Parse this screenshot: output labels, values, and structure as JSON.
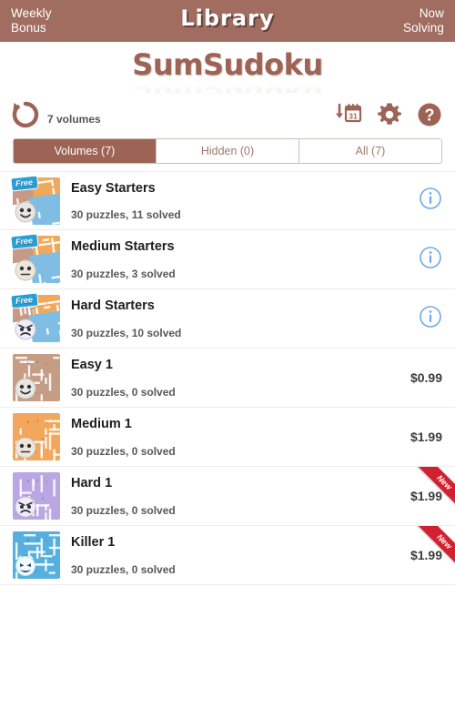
{
  "topbar": {
    "left_line1": "Weekly",
    "left_line2": "Bonus",
    "title": "Library",
    "right_line1": "Now",
    "right_line2": "Solving",
    "background_color": "#a06d60"
  },
  "logo": {
    "text": "SumSudoku",
    "color": "#9d6354"
  },
  "toolbar": {
    "restore_icon": "restore-circular-arrow-icon",
    "volumes_label": "7 volumes",
    "download_icon": "download-calendar-31-icon",
    "calendar_day": "31",
    "settings_icon": "gear-icon",
    "help_icon": "question-mark-circle-icon",
    "icon_color": "#9d6354"
  },
  "tabs": [
    {
      "label": "Volumes (7)",
      "active": true
    },
    {
      "label": "Hidden (0)",
      "active": false
    },
    {
      "label": "All (7)",
      "active": false
    }
  ],
  "accent_color": "#9d6354",
  "info_icon_color": "#6ea8e8",
  "new_ribbon_color": "#d32030",
  "free_badge_color": "#2a9fd6",
  "volumes": [
    {
      "title": "Easy Starters",
      "subtitle": "30 puzzles,  11 solved",
      "free": true,
      "free_label": "Free",
      "new": false,
      "price": "",
      "action": "info",
      "thumb_style": "collage",
      "face": "smile",
      "colors": [
        "#c79a86",
        "#f0a95a",
        "#7fbde4"
      ]
    },
    {
      "title": "Medium Starters",
      "subtitle": "30 puzzles,  3 solved",
      "free": true,
      "free_label": "Free",
      "new": false,
      "price": "",
      "action": "info",
      "thumb_style": "collage",
      "face": "neutral",
      "colors": [
        "#c79a86",
        "#f0a95a",
        "#7fbde4"
      ]
    },
    {
      "title": "Hard Starters",
      "subtitle": "30 puzzles, 10 solved",
      "free": true,
      "free_label": "Free",
      "new": false,
      "price": "",
      "action": "info",
      "thumb_style": "collage",
      "face": "angry",
      "colors": [
        "#c79a86",
        "#f0a95a",
        "#7fbde4"
      ]
    },
    {
      "title": "Easy 1",
      "subtitle": "30 puzzles,  0 solved",
      "free": false,
      "free_label": "",
      "new": false,
      "price": "$0.99",
      "action": "price",
      "thumb_style": "solid",
      "face": "smile",
      "colors": [
        "#c49d84"
      ]
    },
    {
      "title": "Medium 1",
      "subtitle": "30 puzzles,  0 solved",
      "free": false,
      "free_label": "",
      "new": false,
      "price": "$1.99",
      "action": "price",
      "thumb_style": "solid",
      "face": "neutral",
      "colors": [
        "#f2a75c"
      ]
    },
    {
      "title": "Hard 1",
      "subtitle": "30 puzzles,  0 solved",
      "free": false,
      "free_label": "",
      "new": true,
      "new_label": "New",
      "price": "$1.99",
      "action": "price",
      "thumb_style": "solid",
      "face": "angry",
      "colors": [
        "#b9a6e2"
      ]
    },
    {
      "title": "Killer 1",
      "subtitle": "30 puzzles,  0 solved",
      "free": false,
      "free_label": "",
      "new": true,
      "new_label": "New",
      "price": "$1.99",
      "action": "price",
      "thumb_style": "solid",
      "face": "devil",
      "colors": [
        "#55b0de"
      ]
    }
  ]
}
